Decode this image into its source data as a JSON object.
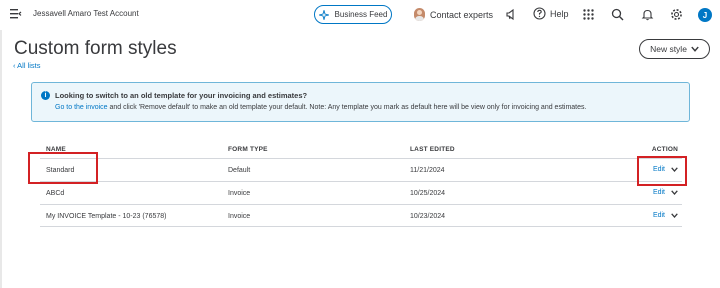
{
  "topbar": {
    "account_name": "Jessavell Amaro Test Account",
    "business_feed_label": "Business Feed",
    "contact_experts_label": "Contact experts",
    "help_label": "Help",
    "user_initial": "J",
    "icons": [
      "menu-icon",
      "sparkle-icon",
      "megaphone-icon",
      "help-icon",
      "apps-grid-icon",
      "search-icon",
      "bell-icon",
      "gear-icon"
    ]
  },
  "header": {
    "title": "Custom form styles",
    "back_link": "All lists",
    "new_style_label": "New style"
  },
  "banner": {
    "title": "Looking to switch to an old template for your invoicing and estimates?",
    "link_text": "Go to the invoice",
    "body_text": " and click 'Remove default' to make an old template your default. Note: Any template you mark as default here will be view only for invoicing and estimates."
  },
  "table": {
    "headers": {
      "name": "NAME",
      "form_type": "FORM TYPE",
      "last_edited": "LAST EDITED",
      "action": "ACTION"
    },
    "rows": [
      {
        "name": "Standard",
        "form_type": "Default",
        "last_edited": "11/21/2024",
        "action": "Edit"
      },
      {
        "name": "ABCd",
        "form_type": "Invoice",
        "last_edited": "10/25/2024",
        "action": "Edit"
      },
      {
        "name": "My INVOICE Template - 10-23 (76578)",
        "form_type": "Invoice",
        "last_edited": "10/23/2024",
        "action": "Edit"
      }
    ]
  },
  "colors": {
    "accent": "#0077c5",
    "highlight": "#d32124",
    "banner_bg": "#ecf6fb"
  }
}
